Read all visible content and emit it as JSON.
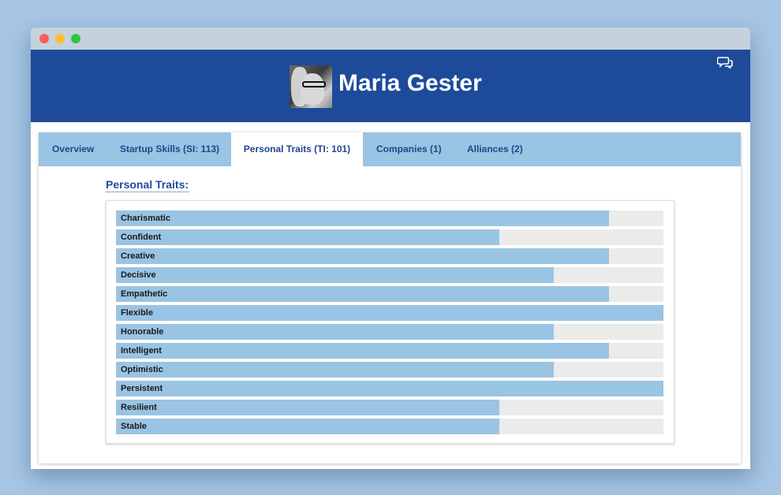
{
  "profile": {
    "name": "Maria Gester",
    "avatar_icon": "profile-photo"
  },
  "header": {
    "background_color": "#1d4b9a",
    "chat_icon": "chat-bubbles-icon"
  },
  "tabs": [
    {
      "label": "Overview",
      "active": false
    },
    {
      "label": "Startup Skills (SI: 113)",
      "active": false
    },
    {
      "label": "Personal Traits (TI: 101)",
      "active": true
    },
    {
      "label": "Companies (1)",
      "active": false
    },
    {
      "label": "Alliances (2)",
      "active": false
    }
  ],
  "section": {
    "title": "Personal Traits:"
  },
  "traits": [
    {
      "label": "Charismatic",
      "level": 0.9
    },
    {
      "label": "Confident",
      "level": 0.7
    },
    {
      "label": "Creative",
      "level": 0.9
    },
    {
      "label": "Decisive",
      "level": 0.8
    },
    {
      "label": "Empathetic",
      "level": 0.9
    },
    {
      "label": "Flexible",
      "level": 1.0
    },
    {
      "label": "Honorable",
      "level": 0.8
    },
    {
      "label": "Intelligent",
      "level": 0.9
    },
    {
      "label": "Optimistic",
      "level": 0.8
    },
    {
      "label": "Persistent",
      "level": 1.0
    },
    {
      "label": "Resilient",
      "level": 0.7
    },
    {
      "label": "Stable",
      "level": 0.7
    }
  ],
  "colors": {
    "accent": "#1d4b9a",
    "bar_fill": "#9ac4e3",
    "bar_track": "#ebebeb"
  }
}
